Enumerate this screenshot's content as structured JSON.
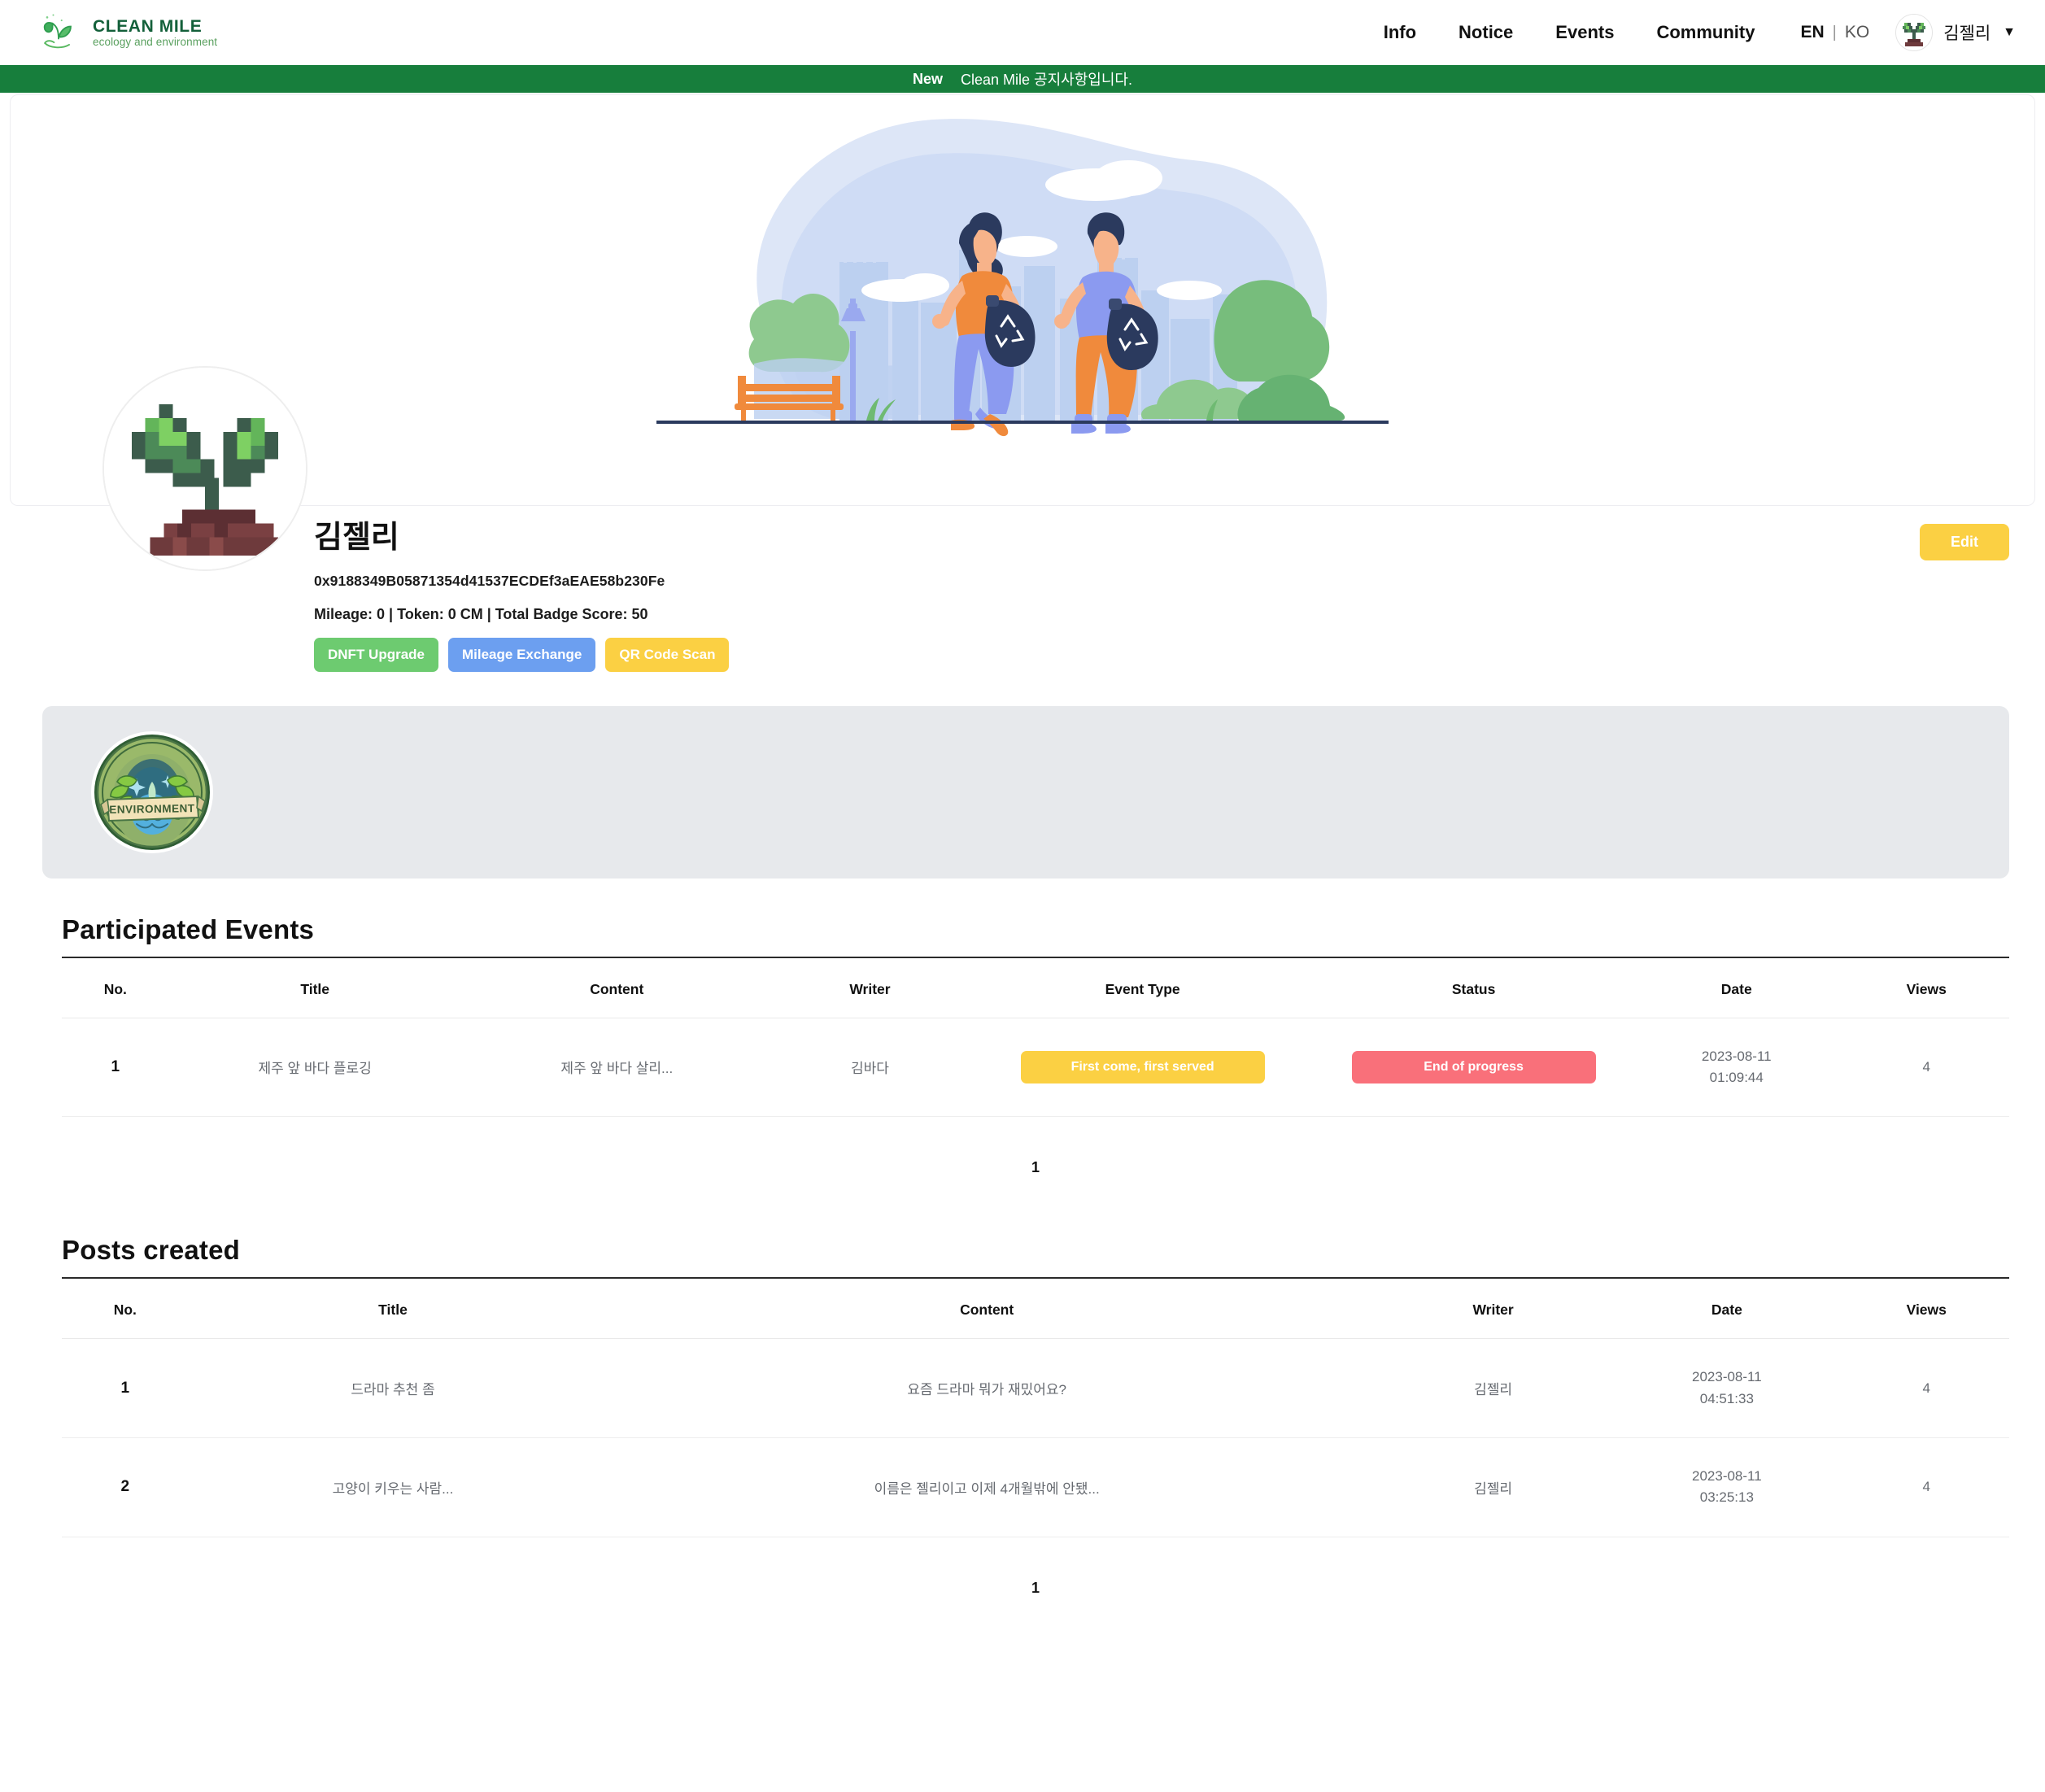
{
  "brand": {
    "title": "CLEAN MILE",
    "subtitle": "ecology and environment",
    "logo_icon": "sprout-in-hand-icon"
  },
  "nav": {
    "items": [
      {
        "label": "Info"
      },
      {
        "label": "Notice"
      },
      {
        "label": "Events"
      },
      {
        "label": "Community"
      }
    ],
    "language": {
      "active": "EN",
      "divider": "|",
      "inactive": "KO"
    },
    "user": {
      "name": "김젤리",
      "avatar_icon": "pixel-sprout-avatar",
      "caret_icon": "chevron-down-icon"
    }
  },
  "notice": {
    "badge": "New",
    "text": "Clean Mile 공지사항입니다."
  },
  "hero": {
    "art_name": "plogging-illustration"
  },
  "profile": {
    "avatar_icon": "pixel-sprout-avatar-large",
    "name": "김젤리",
    "wallet": "0x9188349B05871354d41537ECDEf3aEAE58b230Fe",
    "stats": "Mileage: 0 | Token: 0 CM | Total Badge Score: 50",
    "actions": [
      {
        "label": "DNFT Upgrade",
        "color": "#6DCB70"
      },
      {
        "label": "Mileage Exchange",
        "color": "#6C9FF0"
      },
      {
        "label": "QR Code Scan",
        "color": "#FBD043"
      }
    ],
    "edit_label": "Edit"
  },
  "badges": {
    "items": [
      {
        "name": "environment-badge",
        "caption": "ENVIRONMENT"
      }
    ]
  },
  "events_section": {
    "title": "Participated Events",
    "columns": [
      "No.",
      "Title",
      "Content",
      "Writer",
      "Event Type",
      "Status",
      "Date",
      "Views"
    ],
    "rows": [
      {
        "no": "1",
        "title": "제주 앞 바다 플로깅",
        "content": "제주 앞 바다 살리...",
        "writer": "김바다",
        "event_type": "First come, first served",
        "status": "End of progress",
        "date_day": "2023-08-11",
        "date_time": "01:09:44",
        "views": "4"
      }
    ],
    "pagination": "1"
  },
  "posts_section": {
    "title": "Posts created",
    "columns": [
      "No.",
      "Title",
      "Content",
      "Writer",
      "Date",
      "Views"
    ],
    "rows": [
      {
        "no": "1",
        "title": "드라마 추천 좀",
        "content": "요즘 드라마 뭐가 재밌어요?",
        "writer": "김젤리",
        "date_day": "2023-08-11",
        "date_time": "04:51:33",
        "views": "4"
      },
      {
        "no": "2",
        "title": "고양이 키우는 사람...",
        "content": "이름은 젤리이고 이제 4개월밖에 안됐...",
        "writer": "김젤리",
        "date_day": "2023-08-11",
        "date_time": "03:25:13",
        "views": "4"
      }
    ],
    "pagination": "1"
  },
  "colors": {
    "brand_green": "#177E3C",
    "accent_yellow": "#FBD043",
    "accent_green": "#6DCB70",
    "accent_blue": "#6C9FF0",
    "accent_red": "#F9707A",
    "panel_gray": "#E7E9EC"
  }
}
